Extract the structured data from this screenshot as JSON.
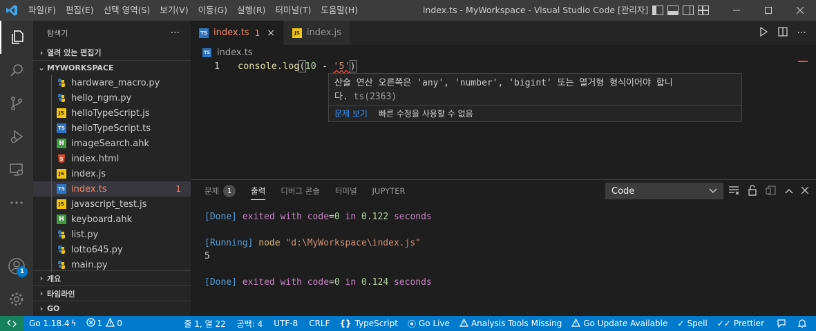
{
  "titlebar": {
    "menu": [
      "파일(F)",
      "편집(E)",
      "선택 영역(S)",
      "보기(V)",
      "이동(G)",
      "실행(R)",
      "터미널(T)",
      "도움말(H)"
    ],
    "title": "index.ts - MyWorkspace - Visual Studio Code [관리자]"
  },
  "activitybar": {
    "accounts_badge": "1"
  },
  "sidebar": {
    "header": "탐색기",
    "more": "···",
    "open_editors": "열려 있는 편집기",
    "workspace": "MYWORKSPACE",
    "files": [
      {
        "name": "hardware_macro.py",
        "type": "py"
      },
      {
        "name": "hello_ngm.py",
        "type": "py"
      },
      {
        "name": "helloTypeScript.js",
        "type": "js"
      },
      {
        "name": "helloTypeScript.ts",
        "type": "ts"
      },
      {
        "name": "imageSearch.ahk",
        "type": "ahk"
      },
      {
        "name": "index.html",
        "type": "html"
      },
      {
        "name": "index.js",
        "type": "js"
      },
      {
        "name": "index.ts",
        "type": "ts",
        "badge": "1"
      },
      {
        "name": "javascript_test.js",
        "type": "js"
      },
      {
        "name": "keyboard.ahk",
        "type": "ahk"
      },
      {
        "name": "list.py",
        "type": "py"
      },
      {
        "name": "lotto645.py",
        "type": "py"
      },
      {
        "name": "main.py",
        "type": "py"
      }
    ],
    "outline": "개요",
    "timeline": "타임라인",
    "go": "GO"
  },
  "editor": {
    "tabs": [
      {
        "label": "index.ts",
        "badge": "1",
        "close": "×"
      },
      {
        "label": "index.js"
      }
    ],
    "breadcrumb": "index.ts",
    "line_number": "1",
    "code": {
      "fn": "console.log",
      "open": "(",
      "num": "10",
      "op": " - ",
      "str": "'5'",
      "close": ")"
    },
    "hover": {
      "message_line1": "산술 연산 오른쪽은 'any', 'number', 'bigint' 또는 열거형 형식이어야 합니",
      "message_line2": "다. ",
      "code_ref": "ts(2363)",
      "view_problem": "문제 보기",
      "no_quick_fix": "빠른 수정을 사용할 수 없음"
    }
  },
  "panel": {
    "tabs": {
      "problems": "문제",
      "problems_count": "1",
      "output": "출력",
      "debug": "디버그 콘솔",
      "terminal": "터미널",
      "jupyter": "JUPYTER"
    },
    "select_value": "Code",
    "output": {
      "l1": {
        "a": "[Done]",
        "b": " exited ",
        "c": "with",
        "d": " code",
        "e": "=",
        "f": "0",
        "g": " in ",
        "h": "0.122",
        "i": " seconds"
      },
      "l3": {
        "a": "[Running]",
        "b": " node ",
        "c": "\"d:\\MyWorkspace\\index.js\""
      },
      "l4": "5",
      "l6": {
        "a": "[Done]",
        "b": " exited ",
        "c": "with",
        "d": " code",
        "e": "=",
        "f": "0",
        "g": " in ",
        "h": "0.124",
        "i": " seconds"
      }
    }
  },
  "statusbar": {
    "go_version": "Go 1.18.4",
    "errors": "1",
    "warnings": "0",
    "position": "줄 1, 열 22",
    "spaces": "공백: 4",
    "encoding": "UTF-8",
    "eol": "CRLF",
    "language": "TypeScript",
    "go_live": "Go Live",
    "analysis": "Analysis Tools Missing",
    "go_update": "Go Update Available",
    "spell": "Spell",
    "prettier": "Prettier"
  },
  "colors": {
    "accent": "#007acc",
    "error": "#f48771",
    "remote": "#16825d"
  }
}
